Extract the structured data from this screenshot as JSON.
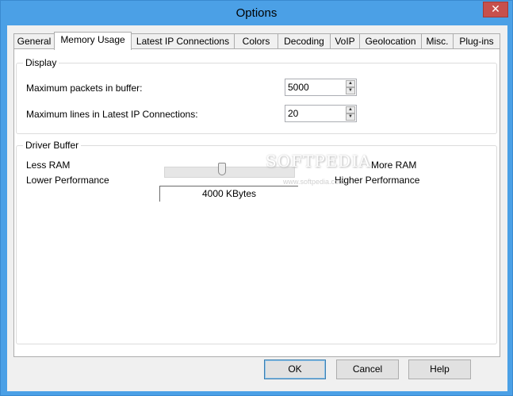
{
  "window": {
    "title": "Options",
    "close_glyph": "✕"
  },
  "tabs": [
    {
      "label": "General"
    },
    {
      "label": "Memory Usage"
    },
    {
      "label": "Latest IP Connections"
    },
    {
      "label": "Colors"
    },
    {
      "label": "Decoding"
    },
    {
      "label": "VoIP"
    },
    {
      "label": "Geolocation"
    },
    {
      "label": "Misc."
    },
    {
      "label": "Plug-ins"
    }
  ],
  "active_tab": "Memory Usage",
  "display_group": {
    "title": "Display",
    "max_packets_label": "Maximum packets in buffer:",
    "max_packets_value": "5000",
    "max_lines_label": "Maximum lines in Latest IP Connections:",
    "max_lines_value": "20"
  },
  "driver_buffer_group": {
    "title": "Driver Buffer",
    "less_ram": "Less RAM",
    "more_ram": "More RAM",
    "lower_perf": "Lower Performance",
    "higher_perf": "Higher Performance",
    "slider_fraction": 0.44,
    "kbytes_value": "4000 KBytes"
  },
  "buttons": {
    "ok": "OK",
    "cancel": "Cancel",
    "help": "Help"
  },
  "icons": {
    "spin_up": "▲",
    "spin_down": "▼"
  },
  "watermark": {
    "main": "SOFTPEDIA",
    "sub": "www.softpedia.com"
  },
  "colors": {
    "titlebar": "#4ba0e6",
    "close": "#c7504c",
    "default_button_border": "#3c7fb1"
  }
}
